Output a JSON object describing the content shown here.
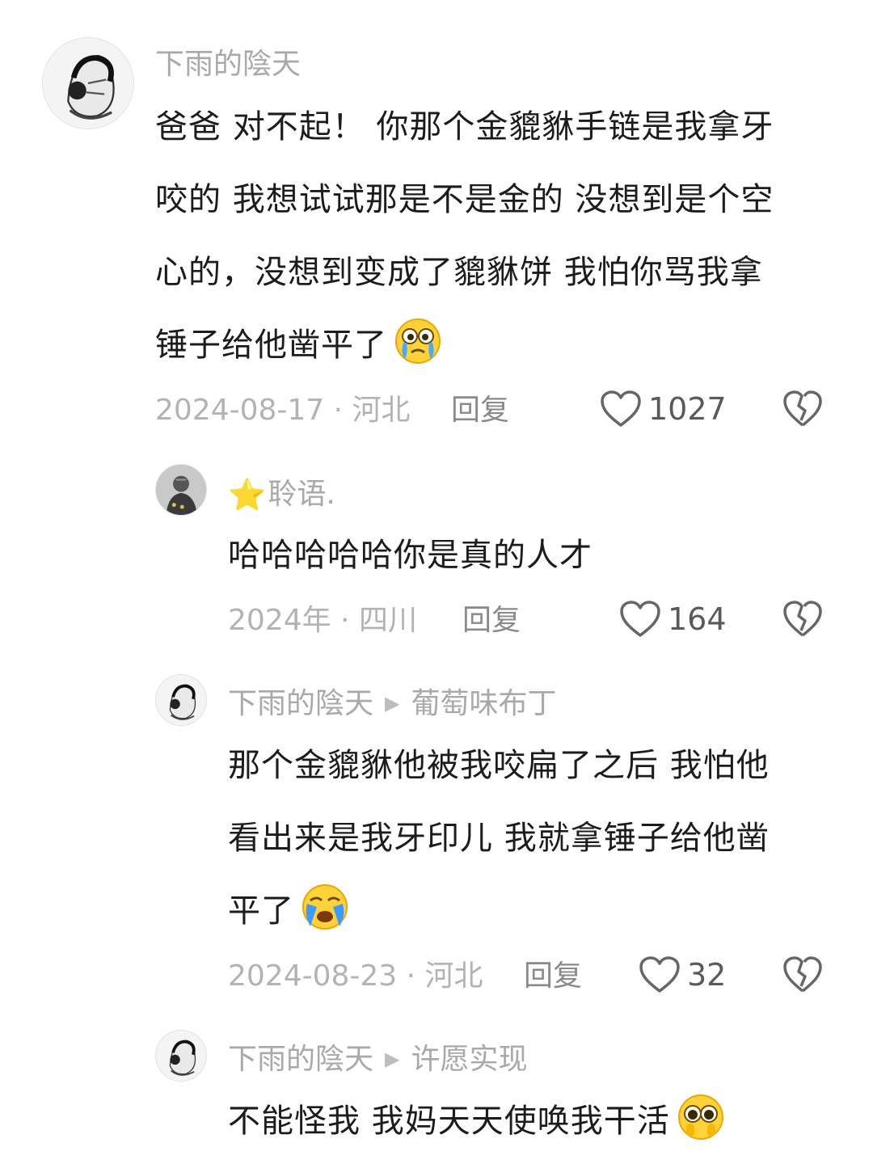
{
  "comments": [
    {
      "username": "下雨的陰天",
      "lines": [
        "爸爸 对不起！ 你那个金貔貅手链是我拿牙",
        "咬的 我想试试那是不是金的 没想到是个空",
        "心的，没想到变成了貔貅饼 我怕你骂我拿",
        "锤子给他凿平了"
      ],
      "emoji": "crying-emoji",
      "meta": "2024-08-17 · 河北",
      "reply_label": "回复",
      "likes": "1027"
    },
    {
      "username": "聆语.",
      "badge": "⭐",
      "lines": [
        "哈哈哈哈哈你是真的人才"
      ],
      "meta": "2024年 · 四川",
      "reply_label": "回复",
      "likes": "164"
    },
    {
      "username": "下雨的陰天",
      "reply_to": "葡萄味布丁",
      "lines": [
        "那个金貔貅他被我咬扁了之后 我怕他",
        "看出来是我牙印儿 我就拿锤子给他凿",
        "平了"
      ],
      "emoji": "loudly-crying-emoji",
      "meta": "2024-08-23 · 河北",
      "reply_label": "回复",
      "likes": "32"
    },
    {
      "username": "下雨的陰天",
      "reply_to": "许愿实现",
      "lines": [
        "不能怪我 我妈天天使唤我干活"
      ],
      "emoji": "pleading-emoji"
    }
  ],
  "icons": {
    "like": "heart-outline-icon",
    "dislike": "broken-heart-icon",
    "reply_arrow": "play-triangle-icon"
  },
  "colors": {
    "username": "#a9a9a9",
    "text": "#1c1c1c",
    "meta": "#b3b3b3"
  }
}
